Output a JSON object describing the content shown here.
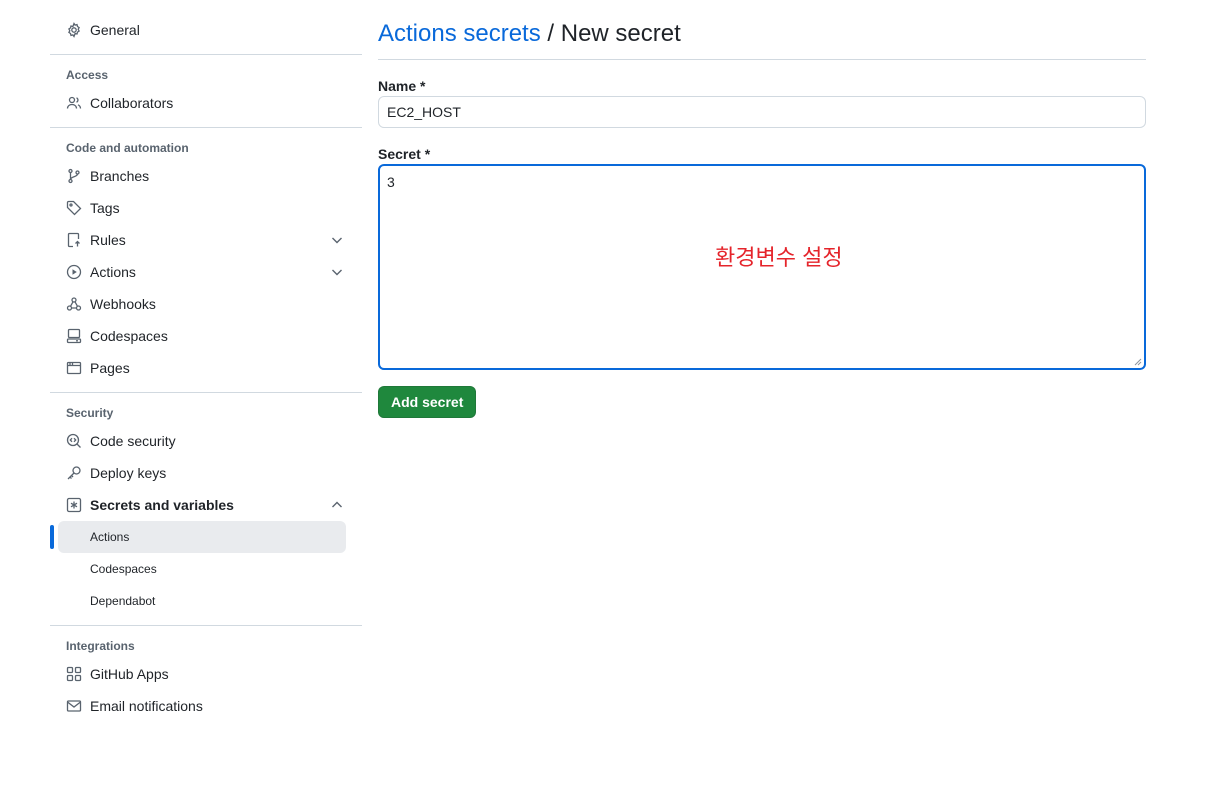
{
  "sidebar": {
    "general": "General",
    "access": {
      "title": "Access",
      "collaborators": "Collaborators"
    },
    "code_automation": {
      "title": "Code and automation",
      "branches": "Branches",
      "tags": "Tags",
      "rules": "Rules",
      "actions": "Actions",
      "webhooks": "Webhooks",
      "codespaces": "Codespaces",
      "pages": "Pages"
    },
    "security": {
      "title": "Security",
      "code_security": "Code security",
      "deploy_keys": "Deploy keys",
      "secrets_variables": "Secrets and variables",
      "sub_actions": "Actions",
      "sub_codespaces": "Codespaces",
      "sub_dependabot": "Dependabot"
    },
    "integrations": {
      "title": "Integrations",
      "github_apps": "GitHub Apps",
      "email_notifications": "Email notifications"
    }
  },
  "main": {
    "breadcrumb_link": "Actions secrets",
    "breadcrumb_sep": " / ",
    "breadcrumb_current": "New secret",
    "name_label": "Name *",
    "name_value": "EC2_HOST",
    "secret_label": "Secret *",
    "secret_value": "3",
    "annotation": "환경변수 설정",
    "submit_label": "Add secret"
  },
  "colors": {
    "accent": "#0969da",
    "primary_button": "#1f883d",
    "annotation": "#e5242b"
  }
}
